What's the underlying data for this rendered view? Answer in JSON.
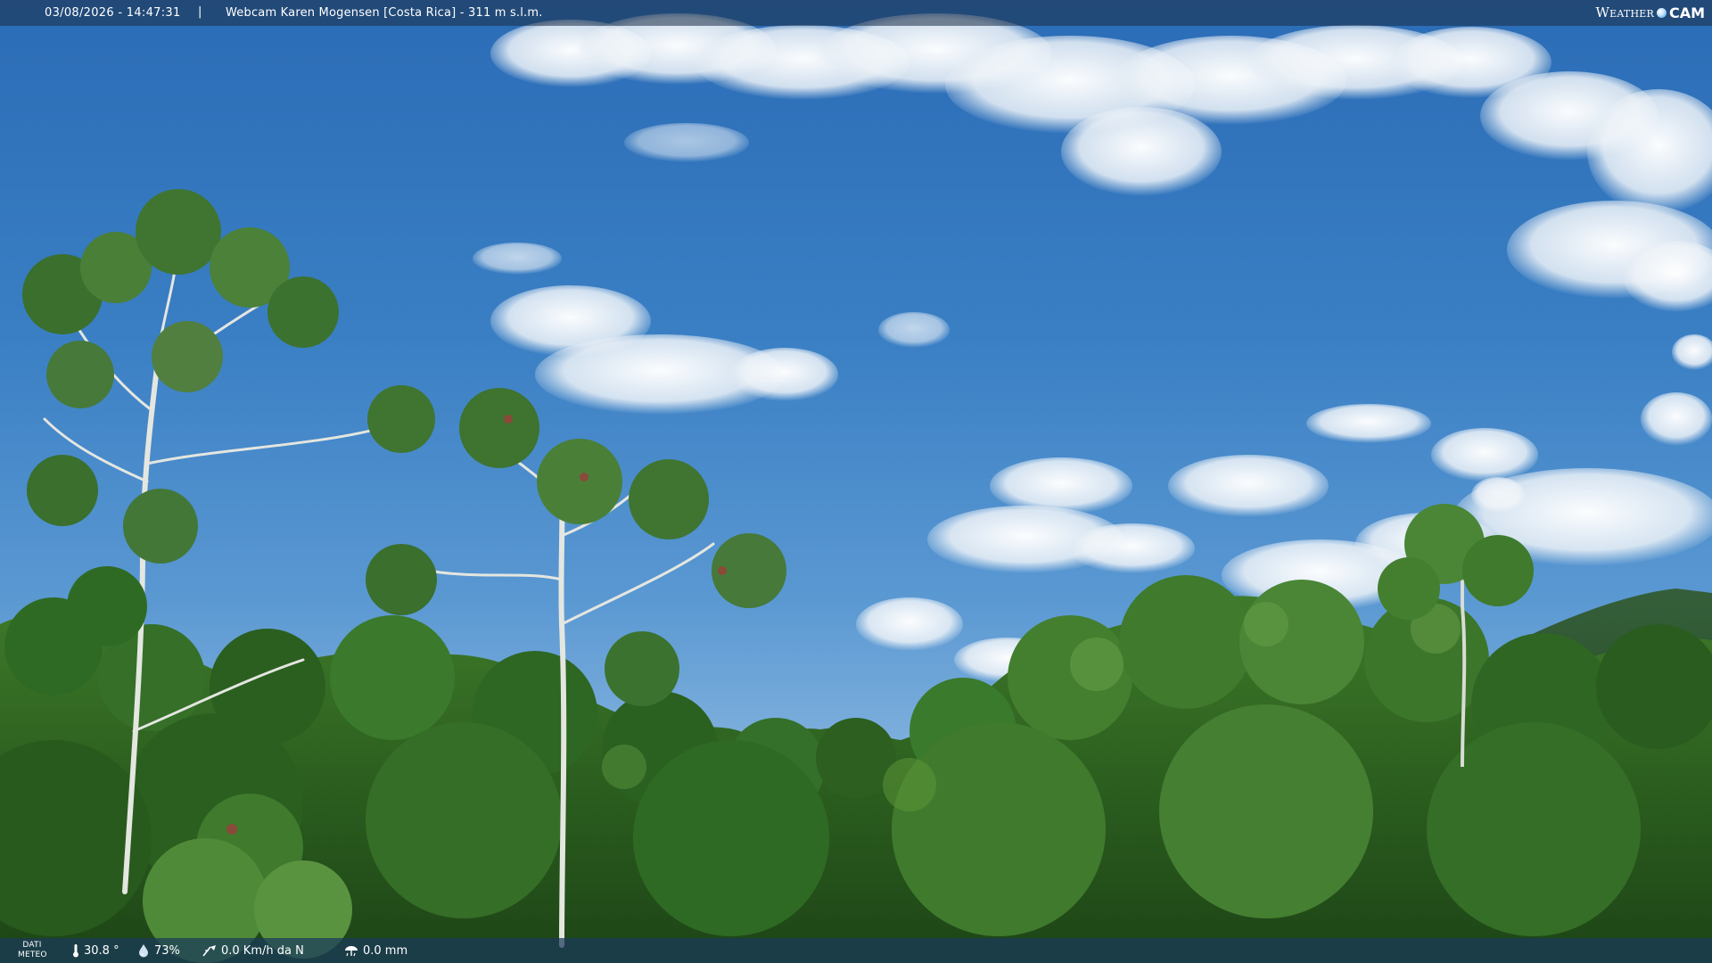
{
  "header": {
    "datetime": "03/08/2026 - 14:47:31",
    "separator": "|",
    "title": "Webcam Karen Mogensen [Costa Rica] - 311 m s.l.m.",
    "brand_left": "Weather",
    "brand_right": "CAM"
  },
  "footer": {
    "dati_line1": "DATI",
    "dati_line2": "METEO",
    "temperature": "30.8 °",
    "humidity": "73%",
    "wind": "0.0 Km/h da N",
    "rain": "0.0 mm"
  },
  "icons": {
    "temperature": "thermometer-icon",
    "humidity": "humidity-drop-icon",
    "wind": "wind-vane-icon",
    "rain": "rain-gauge-icon"
  },
  "colors": {
    "sky_top": "#2b6cb6",
    "sky_horizon": "#9cc2e3",
    "foliage_dark": "#1e4a1a",
    "foliage_light": "#5f9a3a",
    "overlay_bar": "#1c2e46"
  }
}
